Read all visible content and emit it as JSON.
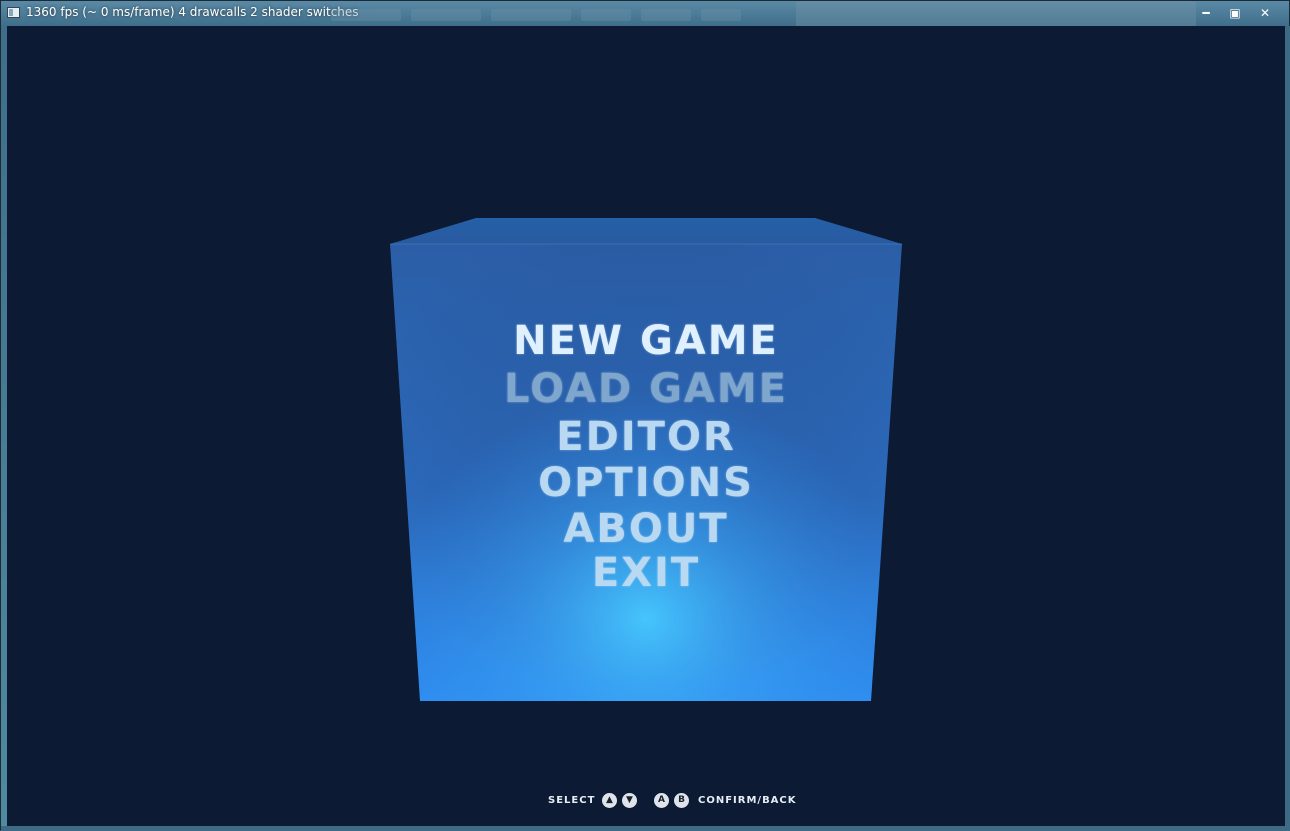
{
  "window": {
    "title": "1360 fps (~ 0 ms/frame) 4 drawcalls 2 shader switches",
    "minimize_glyph": "━",
    "maximize_glyph": "▣",
    "close_glyph": "✕"
  },
  "menu": {
    "items": [
      {
        "label": "NEW GAME"
      },
      {
        "label": "LOAD GAME"
      },
      {
        "label": "EDITOR"
      },
      {
        "label": "OPTIONS"
      },
      {
        "label": "ABOUT"
      },
      {
        "label": "EXIT"
      }
    ],
    "selected_index": 0
  },
  "hints": {
    "select_label": "SELECT",
    "select_buttons": [
      "▲",
      "▼"
    ],
    "confirm_buttons": [
      "A",
      "B"
    ],
    "confirm_label": "CONFIRM/BACK"
  },
  "colors": {
    "viewport_bg": "#0c1a33",
    "cube_top": "#2a5aa0",
    "cube_front_top": "#2b5ea6",
    "cube_front_bottom": "#2f8ef0",
    "cube_glow": "#47c9ff",
    "menu_text": "#b9d8f2"
  }
}
